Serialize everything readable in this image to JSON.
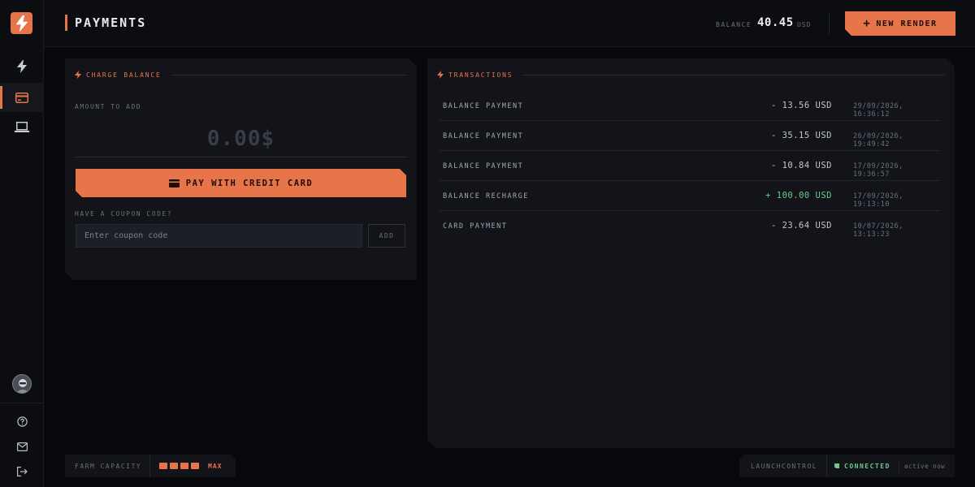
{
  "colors": {
    "accent": "#e8744a",
    "background": "#07080b",
    "panel": "#12141a",
    "success": "#6ec98a"
  },
  "sidebar": {
    "logo_icon": "lightning-bolt-icon",
    "items": [
      {
        "icon": "lightning-icon",
        "name": "renders"
      },
      {
        "icon": "credit-card-icon",
        "name": "payments",
        "active": true
      },
      {
        "icon": "laptop-icon",
        "name": "machines"
      }
    ],
    "utilities": [
      {
        "icon": "help-icon"
      },
      {
        "icon": "mail-icon"
      },
      {
        "icon": "logout-icon"
      }
    ]
  },
  "header": {
    "title": "PAYMENTS",
    "balance_label": "BALANCE",
    "balance_value": "40.45",
    "balance_unit": "USD",
    "new_render_label": "NEW RENDER"
  },
  "charge": {
    "title": "CHARGE BALANCE",
    "amount_label": "AMOUNT TO ADD",
    "amount_value": "0.00$",
    "pay_label": "PAY WITH CREDIT CARD",
    "coupon_label": "HAVE A COUPON CODE?",
    "coupon_placeholder": "Enter coupon code",
    "add_label": "ADD"
  },
  "transactions": {
    "title": "TRANSACTIONS",
    "rows": [
      {
        "name": "BALANCE PAYMENT",
        "amount": "- 13.56 USD",
        "date": "29/09/2026, 16:36:12",
        "type": "debit"
      },
      {
        "name": "BALANCE PAYMENT",
        "amount": "- 35.15 USD",
        "date": "26/09/2026, 19:49:42",
        "type": "debit"
      },
      {
        "name": "BALANCE PAYMENT",
        "amount": "- 10.84 USD",
        "date": "17/09/2026, 19:36:57",
        "type": "debit"
      },
      {
        "name": "BALANCE RECHARGE",
        "amount": "+ 100.00 USD",
        "date": "17/09/2026, 19:13:10",
        "type": "credit"
      },
      {
        "name": "CARD PAYMENT",
        "amount": "- 23.64 USD",
        "date": "10/07/2026, 13:13:23",
        "type": "debit"
      }
    ]
  },
  "footer": {
    "farm_label": "FARM CAPACITY",
    "farm_level": "MAX",
    "farm_blocks": 4,
    "launch_label": "LAUNCHCONTROL",
    "status": "CONNECTED",
    "status_time": "active now"
  }
}
